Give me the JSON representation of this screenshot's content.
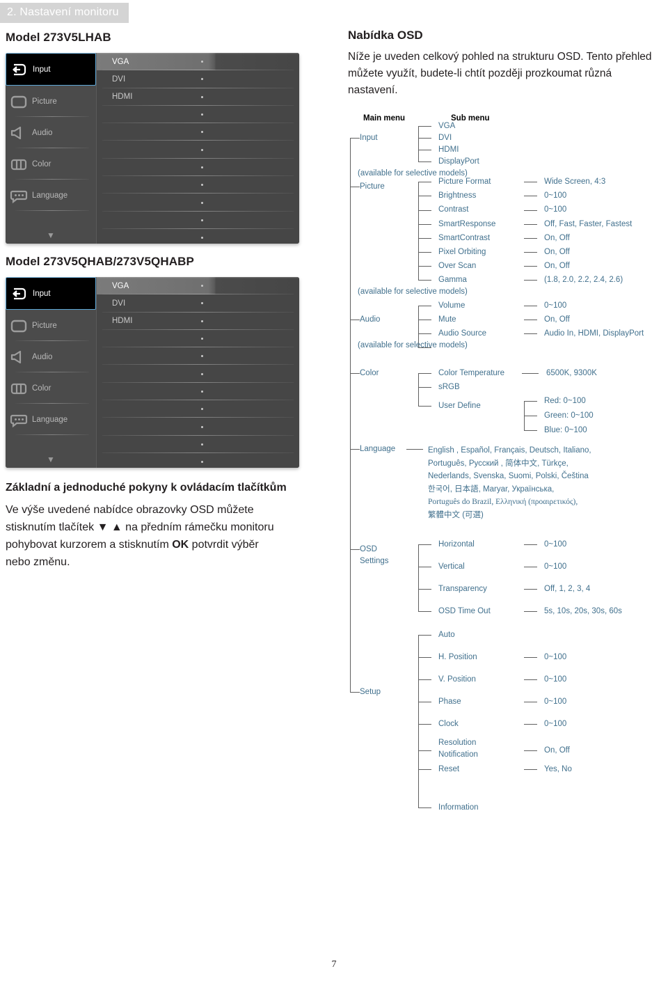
{
  "header": {
    "chapter": "2. Nastavení monitoru"
  },
  "left": {
    "model1_title": "Model 273V5LHAB",
    "model2_title": "Model 273V5QHAB/273V5QHABP",
    "osd_menu_items": [
      {
        "label": "Input",
        "icon": "input-arrow-icon",
        "selected": true
      },
      {
        "label": "Picture",
        "icon": "picture-frame-icon",
        "selected": false
      },
      {
        "label": "Audio",
        "icon": "speaker-icon",
        "selected": false
      },
      {
        "label": "Color",
        "icon": "color-bars-icon",
        "selected": false
      },
      {
        "label": "Language",
        "icon": "speech-bubble-icon",
        "selected": false
      }
    ],
    "osd_options": [
      "VGA",
      "DVI",
      "HDMI",
      "",
      "",
      "",
      "",
      "",
      "",
      "",
      ""
    ],
    "scroll_indicator": "▼",
    "instructions_title": "Základní a jednoduché pokyny k ovládacím tlačítkům",
    "instructions_body_1": "Ve výše uvedené nabídce obrazovky OSD můžete stisknutím tlačítek ",
    "instructions_arrows": "▼ ▲",
    "instructions_body_2": " na předním rámečku monitoru pohybovat kurzorem a stisknutím ",
    "instructions_ok": "OK",
    "instructions_body_3": " potvrdit výběr nebo změnu."
  },
  "right": {
    "heading": "Nabídka OSD",
    "intro": "Níže je uveden celkový pohled na strukturu OSD. Tento přehled můžete využít, budete-li chtít později prozkoumat různá nastavení.",
    "col_main": "Main menu",
    "col_sub": "Sub menu",
    "tree": {
      "input": {
        "label": "Input",
        "children": [
          "VGA",
          "DVI",
          "HDMI",
          "DisplayPort"
        ],
        "note": "(available for selective models)"
      },
      "picture": {
        "label": "Picture",
        "children": [
          {
            "name": "Picture Format",
            "values": "Wide Screen, 4:3"
          },
          {
            "name": "Brightness",
            "values": "0~100"
          },
          {
            "name": "Contrast",
            "values": "0~100"
          },
          {
            "name": "SmartResponse",
            "values": "Off, Fast, Faster, Fastest"
          },
          {
            "name": "SmartContrast",
            "values": "On, Off"
          },
          {
            "name": "Pixel Orbiting",
            "values": "On, Off"
          },
          {
            "name": "Over Scan",
            "values": "On, Off"
          },
          {
            "name": "Gamma",
            "values": "(1.8, 2.0, 2.2, 2.4, 2.6)"
          }
        ],
        "note": "(available for selective models)"
      },
      "audio": {
        "label": "Audio",
        "children": [
          {
            "name": "Volume",
            "values": "0~100"
          },
          {
            "name": "Mute",
            "values": "On, Off"
          },
          {
            "name": "Audio Source",
            "values": "Audio In, HDMI, DisplayPort"
          }
        ],
        "note": "(available for selective models)"
      },
      "color": {
        "label": "Color",
        "children": [
          {
            "name": "Color Temperature",
            "values": "6500K, 9300K"
          },
          {
            "name": "sRGB",
            "values": ""
          },
          {
            "name": "User Define",
            "values": ""
          }
        ],
        "user_define": [
          "Red: 0~100",
          "Green: 0~100",
          "Blue: 0~100"
        ]
      },
      "language": {
        "label": "Language",
        "lines": [
          "English , Español, Français, Deutsch, Italiano,",
          "Português, Русский , 简体中文, Türkçe,",
          "Nederlands, Svenska, Suomi, Polski, Čeština",
          "한국어, 日本語, Maryar, Українська,",
          "Português do Brazil, Ελληνική (προαιρετικός),",
          "繁體中文 (可選)"
        ]
      },
      "osd_settings": {
        "label_line1": "OSD",
        "label_line2": "Settings",
        "children": [
          {
            "name": "Horizontal",
            "values": "0~100"
          },
          {
            "name": "Vertical",
            "values": "0~100"
          },
          {
            "name": "Transparency",
            "values": "Off, 1, 2, 3, 4"
          },
          {
            "name": "OSD Time Out",
            "values": "5s, 10s, 20s, 30s, 60s"
          }
        ]
      },
      "setup": {
        "label": "Setup",
        "children": [
          {
            "name": "Auto",
            "values": ""
          },
          {
            "name": "H. Position",
            "values": "0~100"
          },
          {
            "name": "V. Position",
            "values": "0~100"
          },
          {
            "name": "Phase",
            "values": "0~100"
          },
          {
            "name": "Clock",
            "values": "0~100"
          },
          {
            "name": "Resolution Notification",
            "values": "On, Off",
            "name_line1": "Resolution",
            "name_line2": "Notification"
          },
          {
            "name": "Reset",
            "values": "Yes, No"
          },
          {
            "name": "Information",
            "values": ""
          }
        ]
      }
    }
  },
  "footer": {
    "page_number": "7"
  },
  "colors": {
    "tree_text": "#41708d",
    "osd_selected_border": "#5ea8d8",
    "header_bg": "#d4d4d4"
  }
}
